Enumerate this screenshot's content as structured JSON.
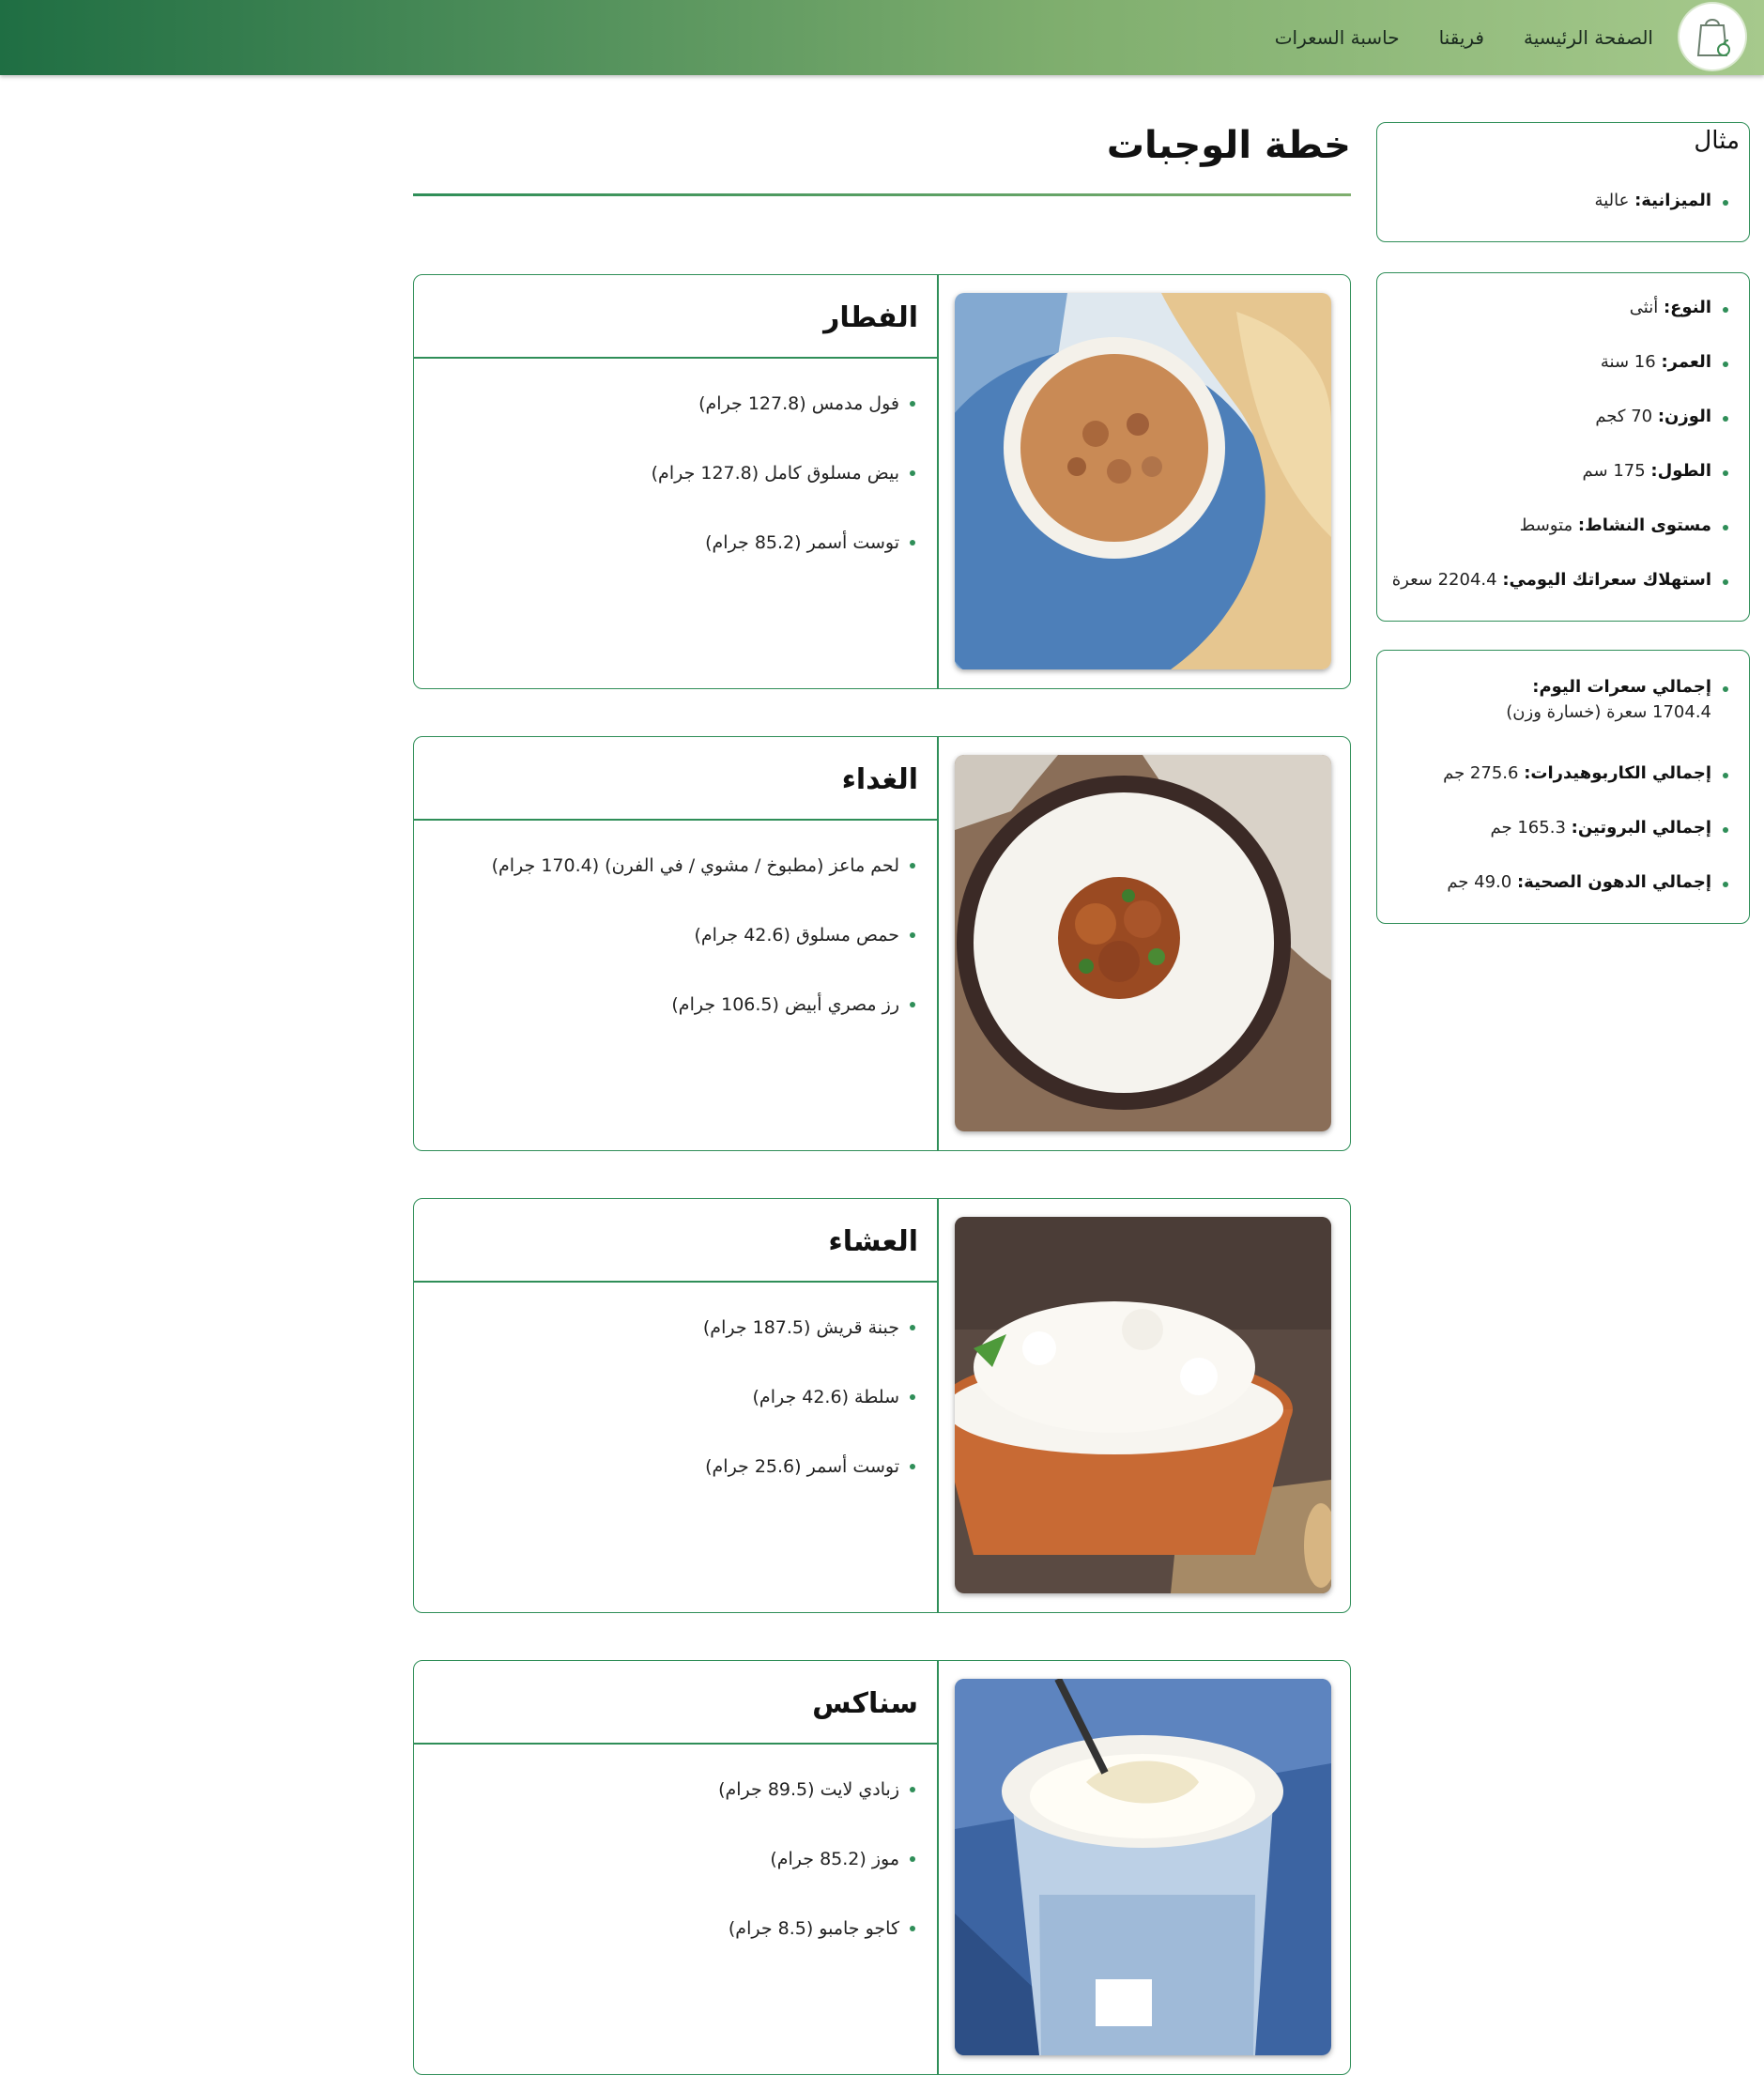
{
  "nav": {
    "logo_icon": "grocery-bag-icon",
    "items": [
      {
        "label": "الصفحة الرئيسية"
      },
      {
        "label": "فريقنا"
      },
      {
        "label": "حاسبة السعرات"
      }
    ]
  },
  "sidebar": {
    "example": {
      "title": "مثال",
      "budget_label": "الميزانية:",
      "budget_value": " عالية"
    },
    "profile": [
      {
        "label": "النوع:",
        "value": " أنثى"
      },
      {
        "label": "العمر:",
        "value": " 16 سنة"
      },
      {
        "label": "الوزن:",
        "value": " 70 كجم"
      },
      {
        "label": "الطول:",
        "value": " 175 سم"
      },
      {
        "label": "مستوى النشاط:",
        "value": " متوسط"
      },
      {
        "label": "استهلاك سعراتك اليومي:",
        "value": " 2204.4 سعرة"
      }
    ],
    "totals": {
      "calories_label": "إجمالي سعرات اليوم:",
      "calories_value": "1704.4 سعرة (خسارة وزن)",
      "carbs_label": "إجمالي الكاربوهيدرات:",
      "carbs_value": " 275.6 جم",
      "protein_label": "إجمالي البروتين:",
      "protein_value": " 165.3 جم",
      "fat_label": "إجمالي الدهون الصحية:",
      "fat_value": " 49.0 جم"
    }
  },
  "main": {
    "title": "خطة الوجبات",
    "meals": [
      {
        "title": "الفطار",
        "image": "foul-with-pita-image",
        "items": [
          "فول مدمس (127.8 جرام)",
          "بيض مسلوق كامل (127.8 جرام)",
          "توست أسمر (85.2 جرام)"
        ]
      },
      {
        "title": "الغداء",
        "image": "rice-with-goat-meat-image",
        "items": [
          "لحم ماعز (مطبوخ / مشوي / في الفرن) (170.4 جرام)",
          "حمص مسلوق (42.6 جرام)",
          "رز مصري أبيض (106.5 جرام)"
        ]
      },
      {
        "title": "العشاء",
        "image": "cottage-cheese-bowl-image",
        "items": [
          "جبنة قريش (187.5 جرام)",
          "سلطة (42.6 جرام)",
          "توست أسمر (25.6 جرام)"
        ]
      },
      {
        "title": "سناكس",
        "image": "yogurt-cup-image",
        "items": [
          "زبادي لايت (89.5 جرام)",
          "موز (85.2 جرام)",
          "كاجو جامبو (8.5 جرام)"
        ]
      }
    ]
  },
  "colors": {
    "accent": "#2f8e58",
    "header_dark": "#1f6e43",
    "header_light": "#a6c98c"
  }
}
